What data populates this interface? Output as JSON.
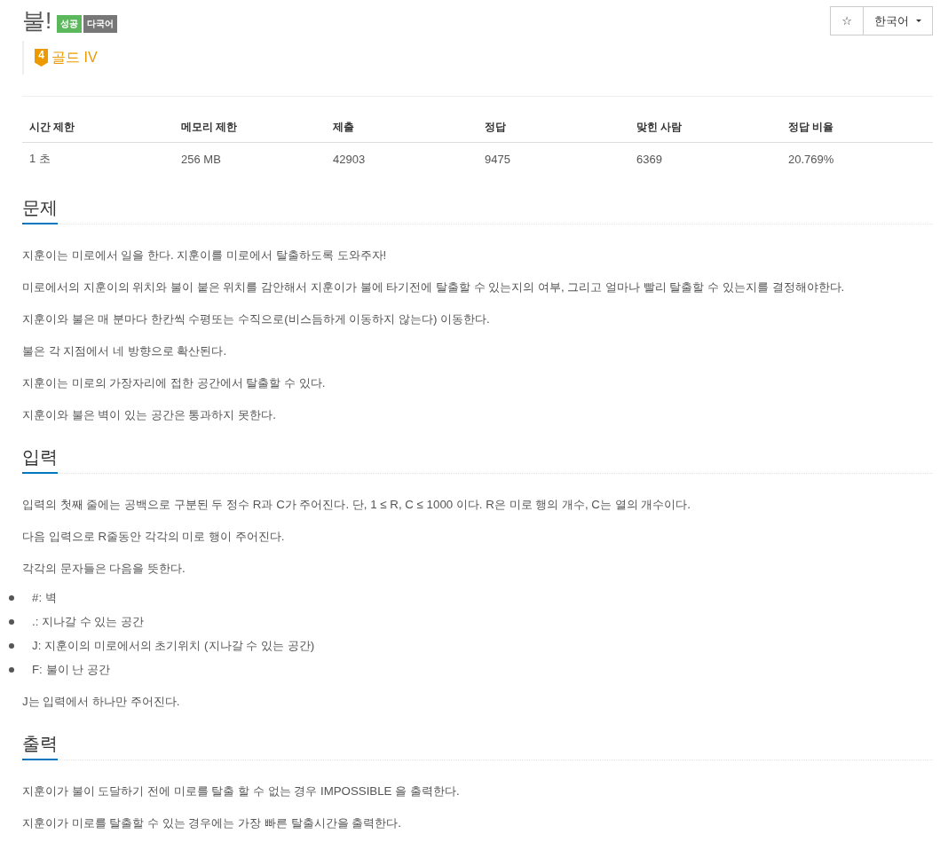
{
  "title": "불!",
  "labels": [
    {
      "kind": "success",
      "text": "성공"
    },
    {
      "kind": "multilang",
      "text": "다국어"
    }
  ],
  "toolbar": {
    "favorite": "☆",
    "language": "한국어"
  },
  "tier": {
    "number": "4",
    "name": "골드 IV"
  },
  "stats": {
    "columns": [
      "시간 제한",
      "메모리 제한",
      "제출",
      "정답",
      "맞힌 사람",
      "정답 비율"
    ],
    "rows": [
      [
        "1 초",
        "256 MB",
        "42903",
        "9475",
        "6369",
        "20.769%"
      ]
    ]
  },
  "sections": [
    {
      "title": "문제",
      "blocks": [
        {
          "kind": "paragraph",
          "text": "지훈이는 미로에서 일을 한다. 지훈이를 미로에서 탈출하도록 도와주자!"
        },
        {
          "kind": "paragraph",
          "text": "미로에서의 지훈이의 위치와 불이 붙은 위치를 감안해서 지훈이가 불에 타기전에 탈출할 수 있는지의 여부, 그리고 얼마나 빨리 탈출할 수 있는지를 결정해야한다."
        },
        {
          "kind": "paragraph",
          "text": "지훈이와 불은 매 분마다 한칸씩 수평또는 수직으로(비스듬하게 이동하지 않는다) 이동한다."
        },
        {
          "kind": "paragraph",
          "text": "불은 각 지점에서 네 방향으로 확산된다."
        },
        {
          "kind": "paragraph",
          "text": "지훈이는 미로의 가장자리에 접한 공간에서 탈출할 수 있다."
        },
        {
          "kind": "paragraph",
          "text": "지훈이와 불은 벽이 있는 공간은 통과하지 못한다."
        }
      ]
    },
    {
      "title": "입력",
      "blocks": [
        {
          "kind": "paragraph",
          "text": "입력의 첫째 줄에는 공백으로 구분된 두 정수 R과 C가 주어진다. 단, 1 ≤ R, C ≤ 1000 이다. R은 미로 행의 개수, C는 열의 개수이다."
        },
        {
          "kind": "paragraph",
          "text": "다음 입력으로 R줄동안 각각의 미로 행이 주어진다."
        },
        {
          "kind": "paragraph",
          "text": "각각의 문자들은 다음을 뜻한다."
        },
        {
          "kind": "list",
          "items": [
            "#: 벽",
            ".: 지나갈 수 있는 공간",
            "J: 지훈이의 미로에서의 초기위치 (지나갈 수 있는 공간)",
            "F: 불이 난 공간"
          ]
        },
        {
          "kind": "paragraph",
          "text": "J는 입력에서 하나만 주어진다."
        }
      ]
    },
    {
      "title": "출력",
      "blocks": [
        {
          "kind": "paragraph",
          "text": "지훈이가 불이 도달하기 전에 미로를 탈출 할 수 없는 경우 IMPOSSIBLE 을 출력한다."
        },
        {
          "kind": "paragraph",
          "text": "지훈이가 미로를 탈출할 수 있는 경우에는 가장 빠른 탈출시간을 출력한다."
        }
      ]
    }
  ]
}
